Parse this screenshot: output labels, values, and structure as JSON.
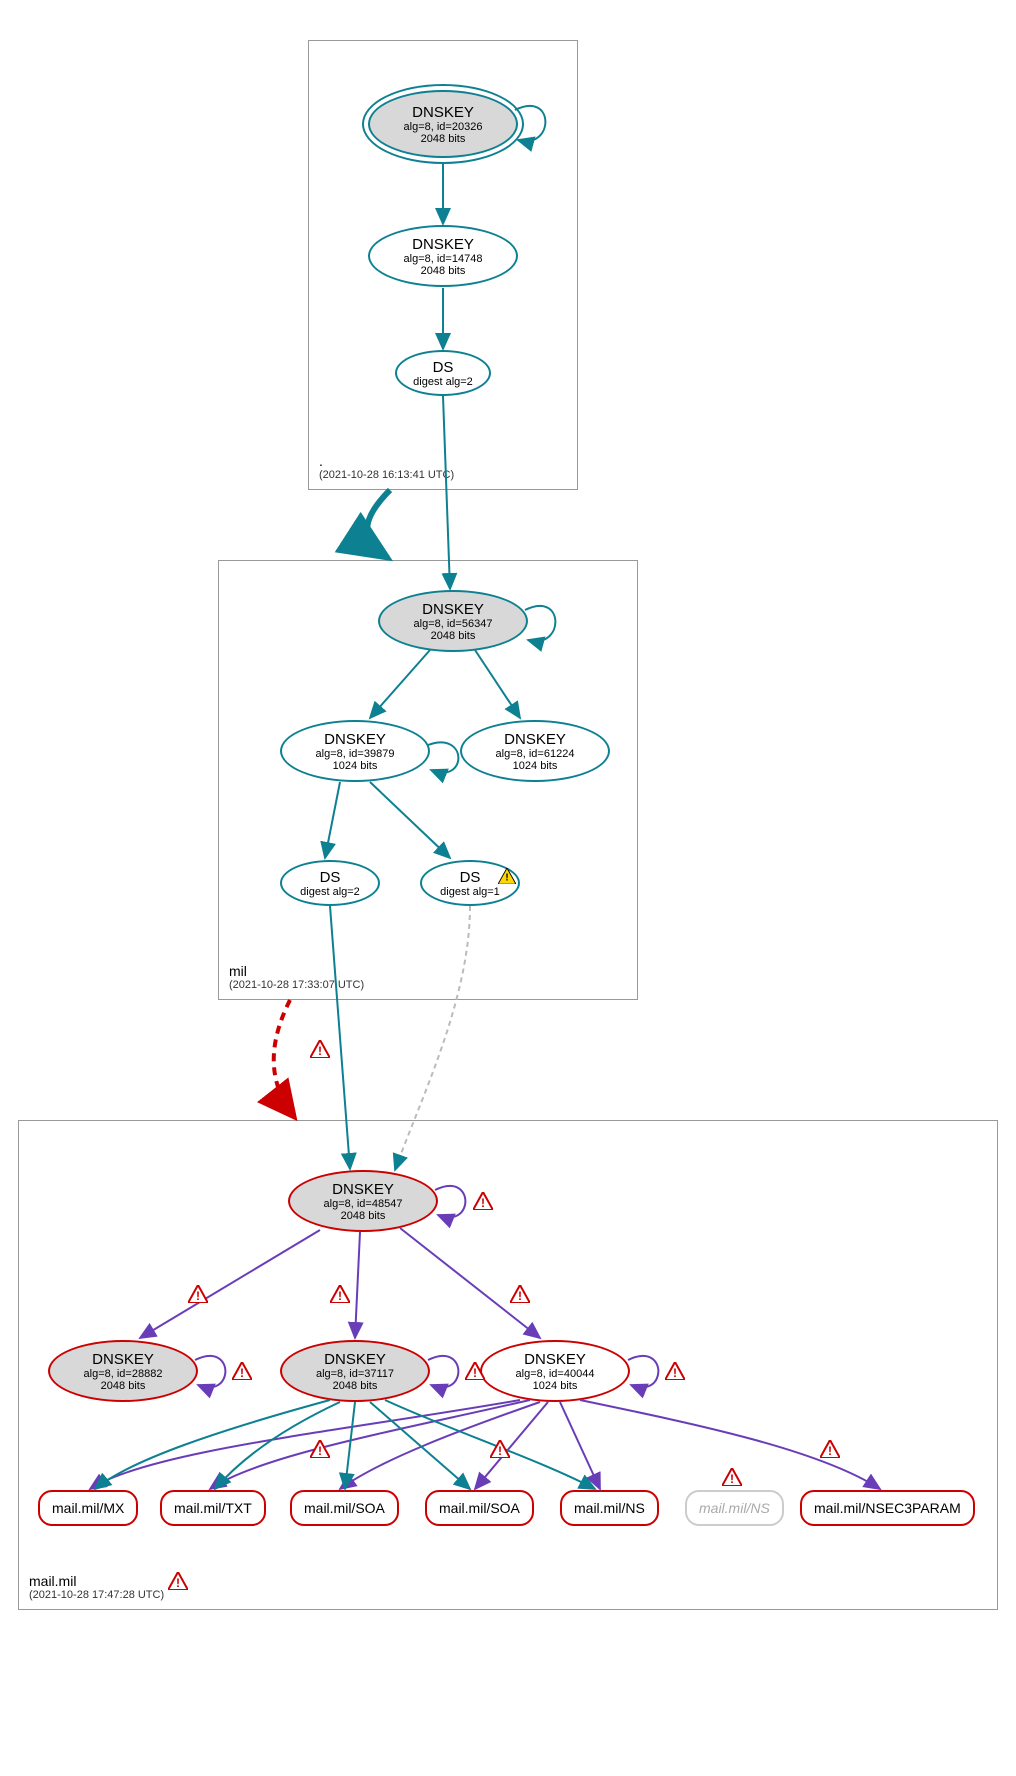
{
  "zones": {
    "root": {
      "name": ".",
      "ts": "(2021-10-28 16:13:41 UTC)"
    },
    "mil": {
      "name": "mil",
      "ts": "(2021-10-28 17:33:07 UTC)"
    },
    "mailmil": {
      "name": "mail.mil",
      "ts": "(2021-10-28 17:47:28 UTC)"
    }
  },
  "nodes": {
    "root_ksk": {
      "title": "DNSKEY",
      "sub1": "alg=8, id=20326",
      "sub2": "2048 bits"
    },
    "root_zsk": {
      "title": "DNSKEY",
      "sub1": "alg=8, id=14748",
      "sub2": "2048 bits"
    },
    "root_ds": {
      "title": "DS",
      "sub1": "digest alg=2"
    },
    "mil_ksk": {
      "title": "DNSKEY",
      "sub1": "alg=8, id=56347",
      "sub2": "2048 bits"
    },
    "mil_zsk1": {
      "title": "DNSKEY",
      "sub1": "alg=8, id=39879",
      "sub2": "1024 bits"
    },
    "mil_zsk2": {
      "title": "DNSKEY",
      "sub1": "alg=8, id=61224",
      "sub2": "1024 bits"
    },
    "mil_ds2": {
      "title": "DS",
      "sub1": "digest alg=2"
    },
    "mil_ds1": {
      "title": "DS",
      "sub1": "digest alg=1"
    },
    "mm_ksk": {
      "title": "DNSKEY",
      "sub1": "alg=8, id=48547",
      "sub2": "2048 bits"
    },
    "mm_k1": {
      "title": "DNSKEY",
      "sub1": "alg=8, id=28882",
      "sub2": "2048 bits"
    },
    "mm_k2": {
      "title": "DNSKEY",
      "sub1": "alg=8, id=37117",
      "sub2": "2048 bits"
    },
    "mm_k3": {
      "title": "DNSKEY",
      "sub1": "alg=8, id=40044",
      "sub2": "1024 bits"
    },
    "rr_mx": "mail.mil/MX",
    "rr_txt": "mail.mil/TXT",
    "rr_soa1": "mail.mil/SOA",
    "rr_soa2": "mail.mil/SOA",
    "rr_ns": "mail.mil/NS",
    "rr_ns2": "mail.mil/NS",
    "rr_nsec3": "mail.mil/NSEC3PARAM"
  }
}
